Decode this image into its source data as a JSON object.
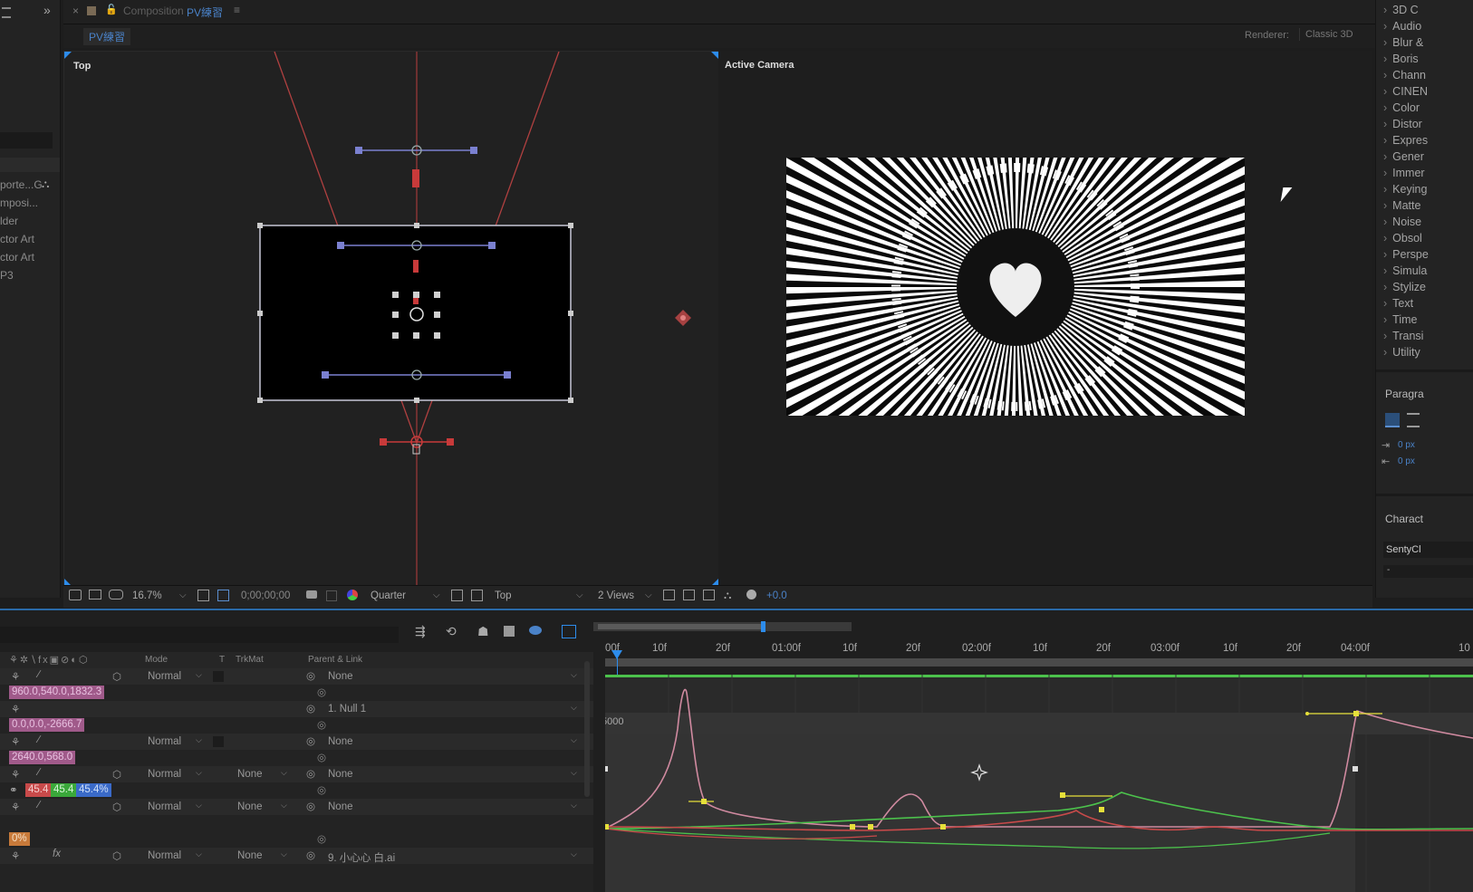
{
  "composition": {
    "tab_label": "Composition",
    "tab_name": "PV練習",
    "subtab": "PV練習",
    "renderer_label": "Renderer:",
    "renderer_value": "Classic 3D"
  },
  "viewers": {
    "left_label": "Top",
    "right_label": "Active Camera"
  },
  "project_panel": {
    "items": [
      "porte...G",
      "mposi...",
      "lder",
      "ctor Art",
      "ctor Art",
      "P3"
    ]
  },
  "viewer_toolbar": {
    "zoom": "16.7%",
    "timecode": "0;00;00;00",
    "resolution": "Quarter",
    "view": "Top",
    "layout": "2 Views",
    "exposure": "+0.0"
  },
  "effects_panel": {
    "categories": [
      "3D C",
      "Audio",
      "Blur &",
      "Boris",
      "Chann",
      "CINEN",
      "Color",
      "Distor",
      "Expres",
      "Gener",
      "Immer",
      "Keying",
      "Matte",
      "Noise",
      "Obsol",
      "Perspe",
      "Simula",
      "Stylize",
      "Text",
      "Time",
      "Transi",
      "Utility"
    ],
    "paragraph_label": "Paragra",
    "indent_1": "0 px",
    "indent_2": "0 px",
    "character_label": "Charact",
    "font_name": "SentyCl",
    "font_style": "-"
  },
  "timeline": {
    "column_headers": {
      "mode": "Mode",
      "t": "T",
      "trkmat": "TrkMat",
      "parent": "Parent & Link"
    },
    "layers": [
      {
        "mode": "Normal",
        "trkmat": "",
        "parent": "None"
      },
      {
        "mode": "",
        "trkmat": "",
        "parent": "1. Null 1"
      },
      {
        "mode": "Normal",
        "trkmat": "",
        "parent": "None"
      },
      {
        "mode": "Normal",
        "trkmat": "None",
        "parent": "None"
      },
      {
        "mode": "Normal",
        "trkmat": "None",
        "parent": "None"
      },
      {
        "mode": "Normal",
        "trkmat": "None",
        "parent": "9. 小心心 白.ai"
      }
    ],
    "properties": {
      "position_1": "960.0,540.0,1832.3",
      "position_2": "0.0,0.0,-2666.7",
      "position_3": "2640.0,568.0",
      "scale_x": "45.4",
      "scale_y": "45.4",
      "scale_z": "45.4%",
      "opacity": "0%"
    },
    "ruler_ticks": [
      "00f",
      "10f",
      "20f",
      "01:00f",
      "10f",
      "20f",
      "02:00f",
      "10f",
      "20f",
      "03:00f",
      "10f",
      "20f",
      "04:00f",
      "10"
    ],
    "graph_value_label": "5000"
  },
  "colors": {
    "accent_blue": "#2d8ceb",
    "graph_pink": "#d08aa0",
    "graph_green": "#4cc24c",
    "graph_red": "#c84a4a",
    "keyframe_yellow": "#e6e03a"
  }
}
